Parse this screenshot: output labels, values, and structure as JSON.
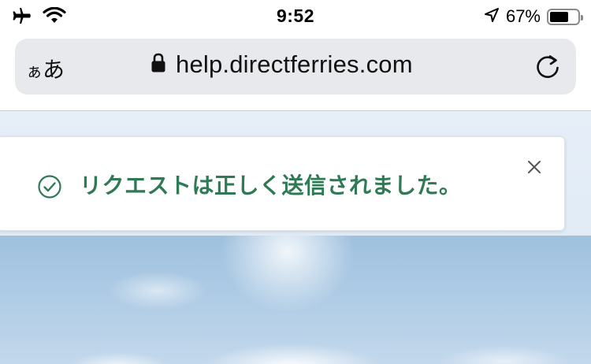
{
  "status_bar": {
    "time": "9:52",
    "battery_percent": "67%",
    "battery_level": 0.67,
    "icons": [
      "airplane-icon",
      "wifi-icon",
      "location-arrow-icon",
      "battery-icon"
    ]
  },
  "address_bar": {
    "text_size_button_small": "ぁ",
    "text_size_button_large": "あ",
    "url": "help.directferries.com",
    "icons": [
      "lock-icon",
      "reload-icon"
    ]
  },
  "toast": {
    "message": "リクエストは正しく送信されました。",
    "icons": [
      "check-circle-icon",
      "close-icon"
    ],
    "accent_color": "#2f7a55"
  }
}
